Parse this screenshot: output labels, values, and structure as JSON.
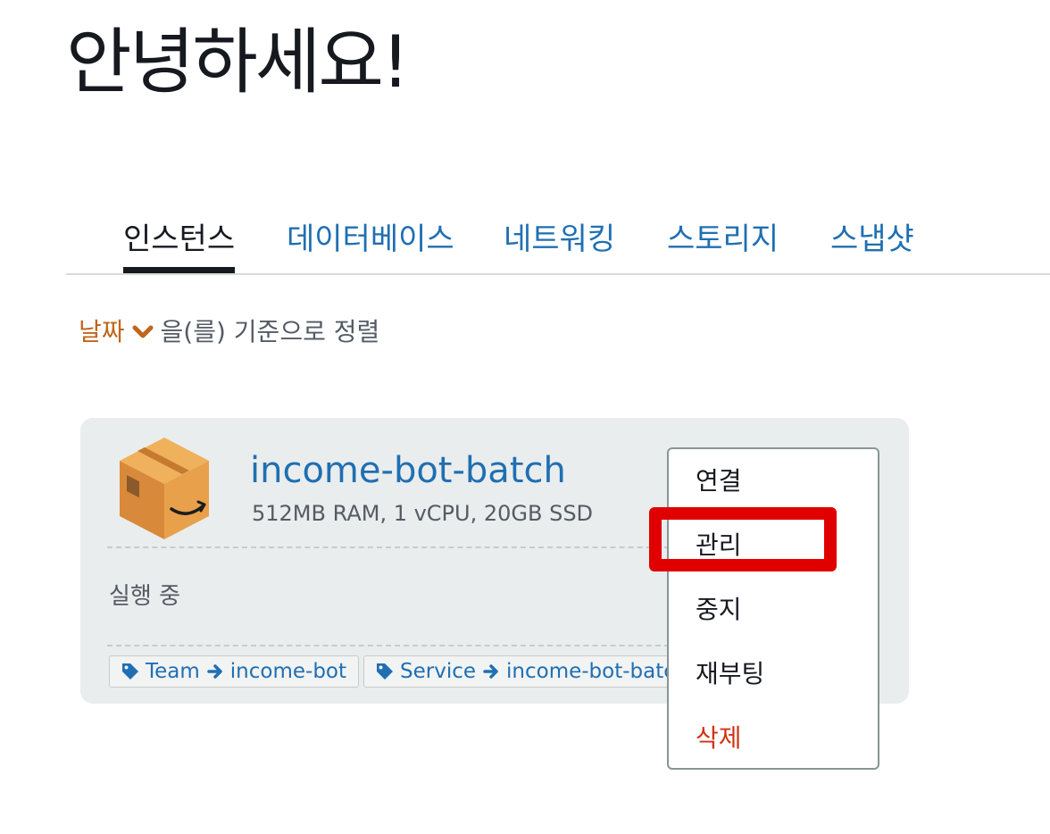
{
  "greeting": "안녕하세요!",
  "tabs": [
    {
      "label": "인스턴스",
      "active": true
    },
    {
      "label": "데이터베이스",
      "active": false
    },
    {
      "label": "네트워킹",
      "active": false
    },
    {
      "label": "스토리지",
      "active": false
    },
    {
      "label": "스냅샷",
      "active": false
    }
  ],
  "sort": {
    "key": "날짜",
    "suffix": "을(를) 기준으로 정렬",
    "icon": "chevron-down-icon"
  },
  "instance": {
    "name": "income-bot-batch",
    "specs": "512MB RAM, 1 vCPU, 20GB SSD",
    "status": "실행 중",
    "icon": "amazon-box-icon",
    "tags": [
      {
        "key": "Team",
        "value": "income-bot",
        "icon": "tag-icon"
      },
      {
        "key": "Service",
        "value": "income-bot-batch",
        "icon": "tag-icon"
      }
    ]
  },
  "menu": {
    "items": [
      {
        "label": "연결",
        "danger": false
      },
      {
        "label": "관리",
        "danger": false,
        "highlighted": true
      },
      {
        "label": "중지",
        "danger": false
      },
      {
        "label": "재부팅",
        "danger": false
      },
      {
        "label": "삭제",
        "danger": true
      }
    ]
  },
  "colors": {
    "link": "#1f6fb2",
    "sort_accent": "#c0661a",
    "danger": "#d13212",
    "highlight": "#e00000",
    "card_bg": "#eaeded"
  }
}
